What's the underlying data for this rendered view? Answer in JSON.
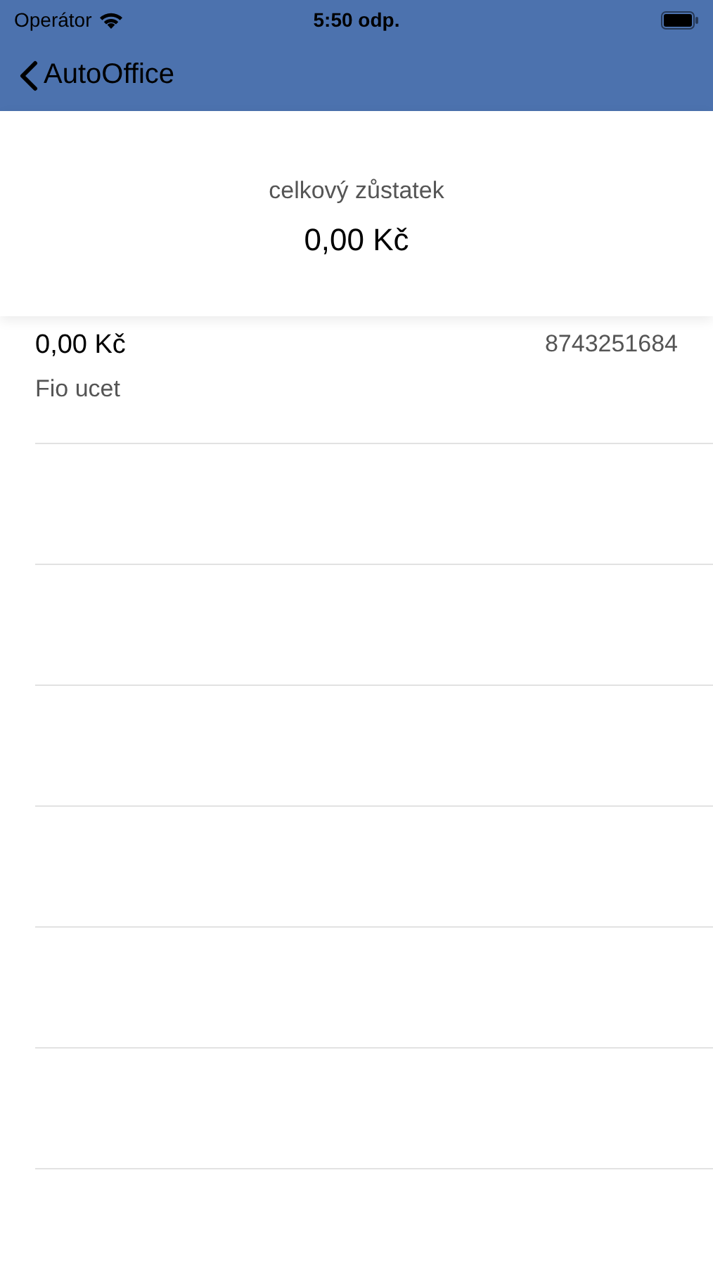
{
  "status_bar": {
    "carrier": "Operátor",
    "time": "5:50 odp."
  },
  "nav_bar": {
    "back_label": "AutoOffice"
  },
  "summary": {
    "label": "celkový zůstatek",
    "amount": "0,00 Kč"
  },
  "accounts": [
    {
      "amount": "0,00 Kč",
      "number": "8743251684",
      "name": "Fio ucet"
    }
  ]
}
